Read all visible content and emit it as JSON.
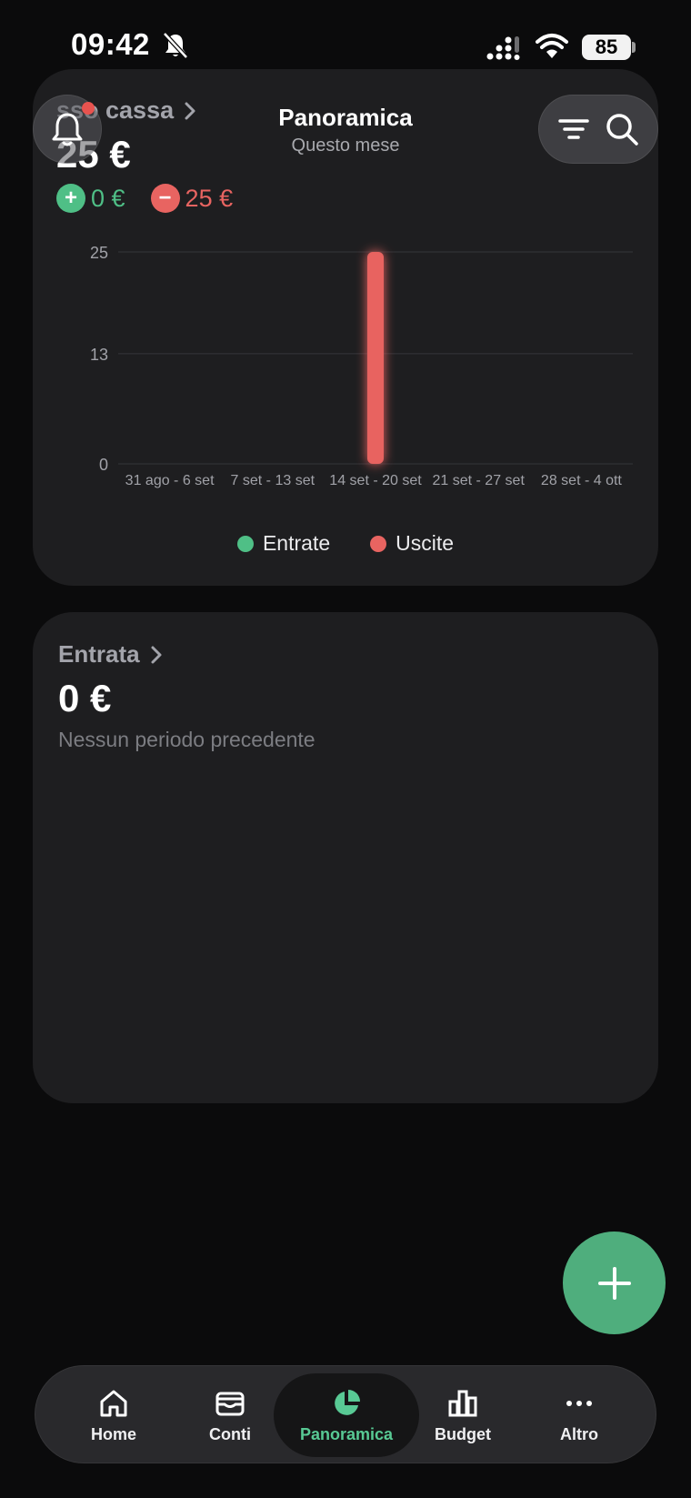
{
  "status_bar": {
    "time": "09:42",
    "battery": "85"
  },
  "header": {
    "title": "Panoramica",
    "subtitle": "Questo mese"
  },
  "cash_card": {
    "title": "sso cassa",
    "value": "25 €",
    "income_chip": "0 €",
    "expense_chip": "25 €",
    "legend": {
      "income": "Entrate",
      "expense": "Uscite"
    }
  },
  "income_card": {
    "title": "Entrata",
    "value": "0 €",
    "subtitle": "Nessun periodo precedente"
  },
  "colors": {
    "income": "#4fbf86",
    "expense": "#e86461",
    "accent": "#4fae7d"
  },
  "chart_data": [
    {
      "type": "bar",
      "categories": [
        "31 ago - 6 set",
        "7 set - 13 set",
        "14 set - 20 set",
        "21 set - 27 set",
        "28 set - 4 ott"
      ],
      "series": [
        {
          "name": "Entrate",
          "values": [
            0,
            0,
            0,
            0,
            0
          ]
        },
        {
          "name": "Uscite",
          "values": [
            0,
            0,
            25,
            0,
            0
          ]
        }
      ],
      "yticks": [
        "25",
        "13",
        "0"
      ],
      "ylim": [
        0,
        25
      ],
      "grid": true,
      "legend": "bottom-center"
    },
    {
      "type": "line",
      "categories": [
        "31 ago - 6 set",
        "7 set - 13 set",
        "7 set - 13 set",
        "14 set - 20 set",
        "21 set - 27 set"
      ],
      "series": [
        {
          "values": [
            0,
            0,
            0,
            0,
            0
          ]
        }
      ],
      "yticks": [
        "0"
      ],
      "ylim": [
        0,
        1
      ],
      "grid": false
    }
  ],
  "tabs": [
    {
      "label": "Home",
      "icon": "home-icon"
    },
    {
      "label": "Conti",
      "icon": "wallet-icon"
    },
    {
      "label": "Panoramica",
      "icon": "pie-chart-icon",
      "active": true
    },
    {
      "label": "Budget",
      "icon": "bar-chart-icon"
    },
    {
      "label": "Altro",
      "icon": "more-icon"
    }
  ]
}
